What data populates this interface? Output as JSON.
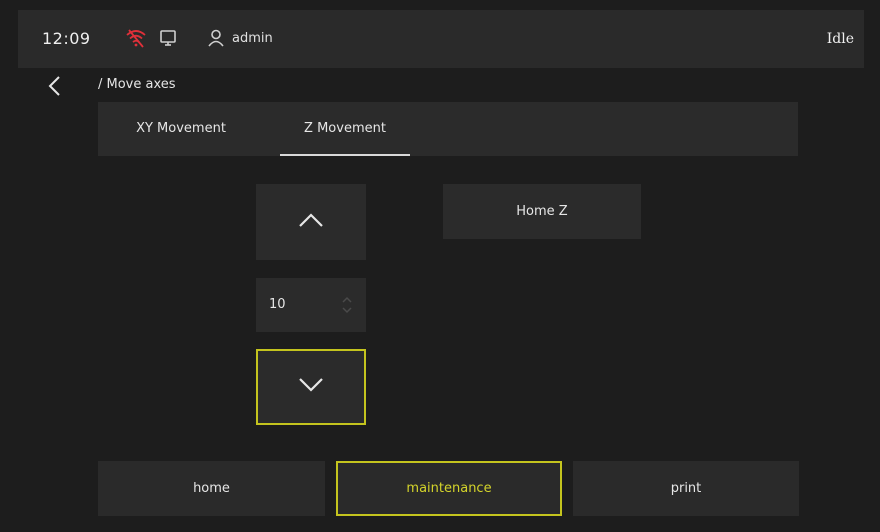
{
  "topbar": {
    "time": "12:09",
    "user": "admin",
    "status": "Idle",
    "icons": {
      "wifi": "wifi-off-icon",
      "monitor": "monitor-icon",
      "user": "user-icon"
    },
    "colors": {
      "wifi_alert": "#e0303a"
    }
  },
  "page": {
    "breadcrumb": "/ Move axes",
    "back_icon": "chevron-left-icon"
  },
  "tabs": [
    {
      "label": "XY Movement",
      "active": false
    },
    {
      "label": "Z Movement",
      "active": true
    }
  ],
  "z_controls": {
    "up_icon": "chevron-up-icon",
    "down_icon": "chevron-down-icon",
    "step_value": "10",
    "home_z_label": "Home Z"
  },
  "bottom_nav": {
    "home": "home",
    "maintenance": "maintenance",
    "print": "print",
    "active": "maintenance"
  },
  "colors": {
    "background": "#1d1d1d",
    "panel": "#2b2b2b",
    "accent": "#c4c41e",
    "text": "#e6e6e6"
  }
}
